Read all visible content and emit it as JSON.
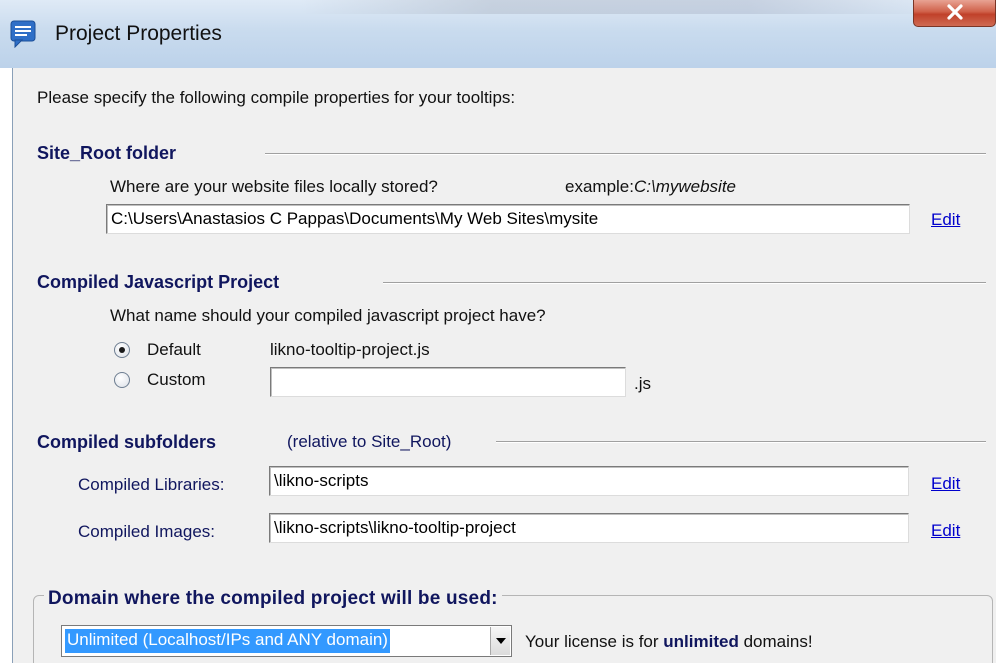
{
  "window": {
    "title": "Project Properties"
  },
  "intro": "Please specify the following compile properties for your tooltips:",
  "site_root": {
    "heading": "Site_Root folder",
    "question": "Where are your website files locally stored?",
    "example_label": "example:",
    "example_value": "C:\\mywebsite",
    "path": "C:\\Users\\Anastasios C Pappas\\Documents\\My Web Sites\\mysite",
    "edit_label": "Edit"
  },
  "compiled_js": {
    "heading": "Compiled Javascript Project",
    "question": "What name should your compiled javascript project have?",
    "default_label": "Default",
    "default_value": "likno-tooltip-project.js",
    "custom_label": "Custom",
    "custom_value": "",
    "ext": ".js",
    "selected": "Default"
  },
  "subfolders": {
    "heading": "Compiled subfolders",
    "note": "(relative to Site_Root)",
    "libraries_label": "Compiled Libraries:",
    "libraries_value": "\\likno-scripts",
    "images_label": "Compiled Images:",
    "images_value": "\\likno-scripts\\likno-tooltip-project",
    "edit_label": "Edit"
  },
  "domain": {
    "heading": "Domain where the compiled project will be used:",
    "selected_option": "Unlimited (Localhost/IPs and ANY domain)",
    "license_prefix": "Your license is for ",
    "license_bold": "unlimited",
    "license_suffix": " domains!"
  },
  "colors": {
    "heading": "#10165e",
    "link": "#0000cc",
    "selection": "#3399ff",
    "close_button": "#c7472f"
  },
  "icons": {
    "app": "speech-bubble-icon",
    "close": "close-icon",
    "dropdown": "chevron-down-icon"
  }
}
